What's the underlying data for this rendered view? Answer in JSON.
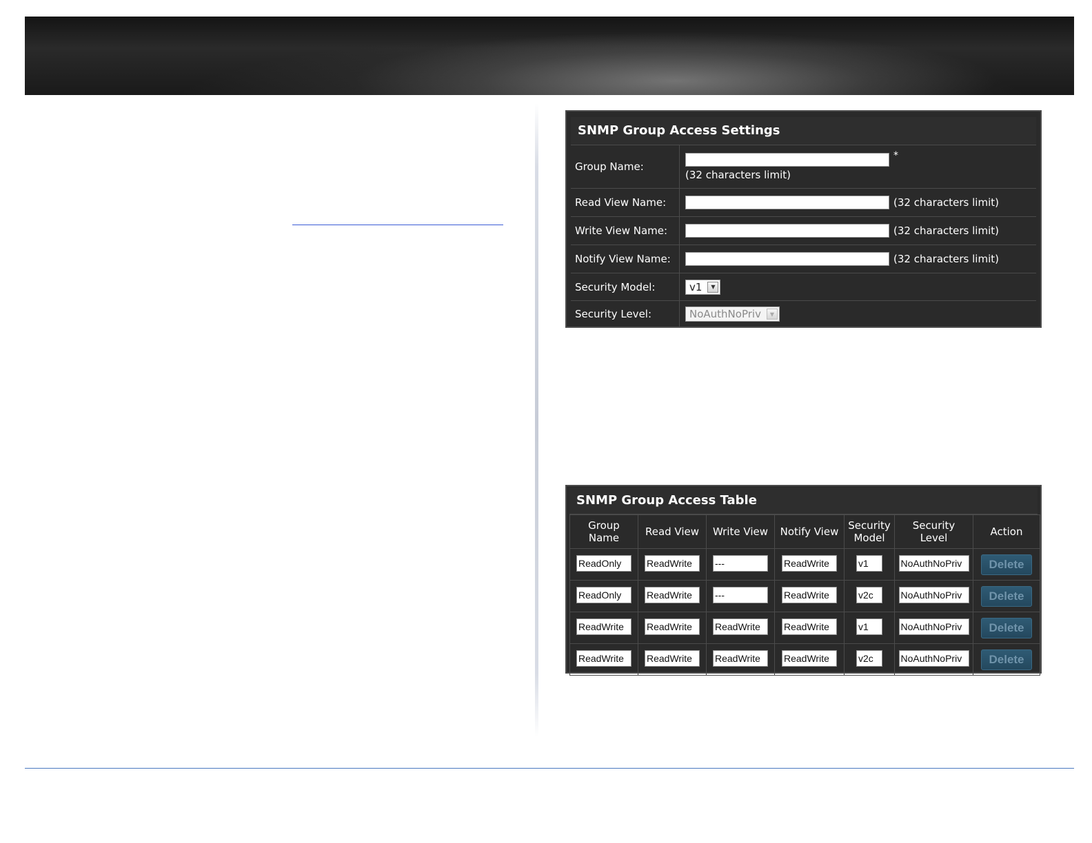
{
  "settings": {
    "title": "SNMP Group Access Settings",
    "group_name_label": "Group Name:",
    "group_name_value": "",
    "group_name_required": "*",
    "group_name_hint": "(32 characters limit)",
    "read_view_label": "Read View Name:",
    "read_view_value": "",
    "read_view_hint": "(32 characters limit)",
    "write_view_label": "Write View Name:",
    "write_view_value": "",
    "write_view_hint": "(32 characters limit)",
    "notify_view_label": "Notify View Name:",
    "notify_view_value": "",
    "notify_view_hint": "(32 characters limit)",
    "security_model_label": "Security Model:",
    "security_model_value": "v1",
    "security_level_label": "Security Level:",
    "security_level_value": "NoAuthNoPriv"
  },
  "table": {
    "title": "SNMP Group Access Table",
    "headers": {
      "group_name_1": "Group",
      "group_name_2": "Name",
      "read_view": "Read View",
      "write_view": "Write View",
      "notify_view": "Notify View",
      "security_model_1": "Security",
      "security_model_2": "Model",
      "security_level_1": "Security",
      "security_level_2": "Level",
      "action": "Action"
    },
    "rows": [
      {
        "group": "ReadOnly",
        "read": "ReadWrite",
        "write": "---",
        "notify": "ReadWrite",
        "model": "v1",
        "level": "NoAuthNoPriv",
        "action": "Delete"
      },
      {
        "group": "ReadOnly",
        "read": "ReadWrite",
        "write": "---",
        "notify": "ReadWrite",
        "model": "v2c",
        "level": "NoAuthNoPriv",
        "action": "Delete"
      },
      {
        "group": "ReadWrite",
        "read": "ReadWrite",
        "write": "ReadWrite",
        "notify": "ReadWrite",
        "model": "v1",
        "level": "NoAuthNoPriv",
        "action": "Delete"
      },
      {
        "group": "ReadWrite",
        "read": "ReadWrite",
        "write": "ReadWrite",
        "notify": "ReadWrite",
        "model": "v2c",
        "level": "NoAuthNoPriv",
        "action": "Delete"
      }
    ]
  },
  "icons": {
    "dropdown_arrow": "chevron-down-icon"
  },
  "colors": {
    "panel_bg": "#2a2a2a",
    "delete_button": "#2f5b74",
    "link_line": "#3a5bd6",
    "footer_line": "#4a78c0"
  }
}
